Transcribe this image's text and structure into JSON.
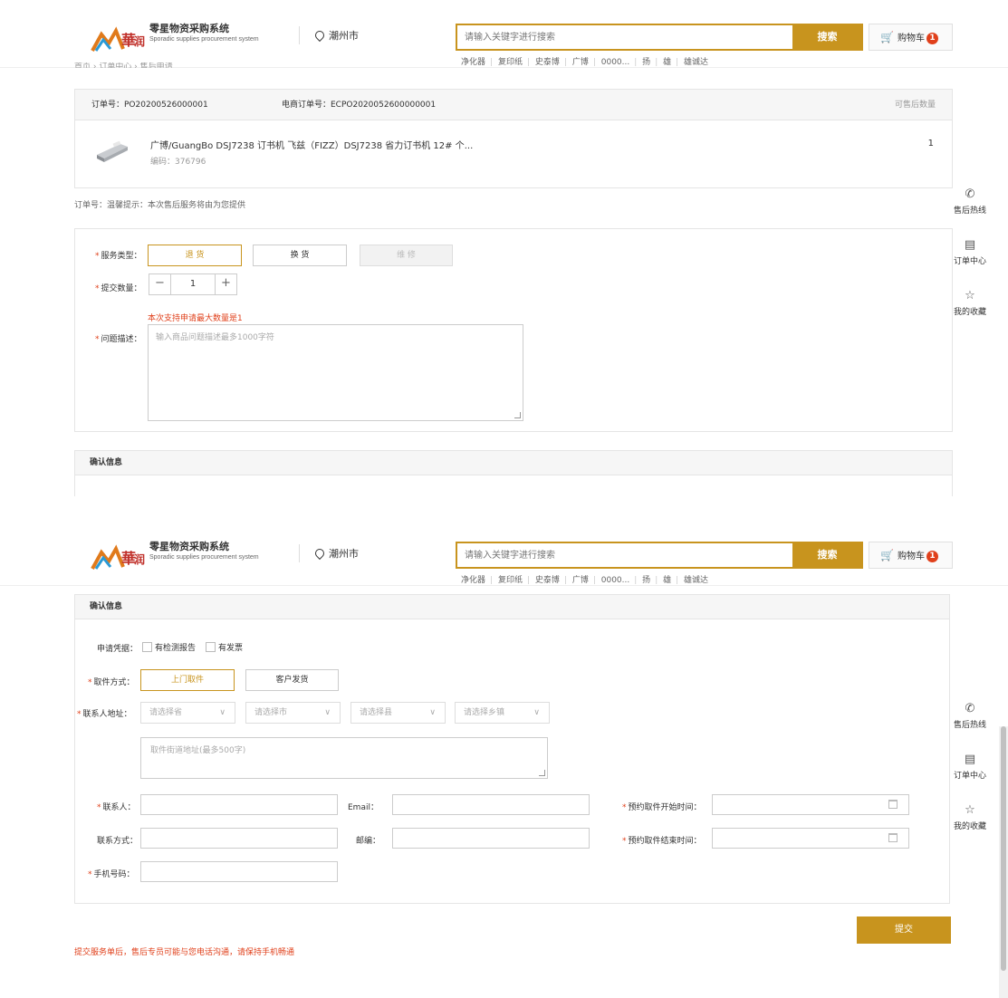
{
  "header": {
    "system_title": "零星物资采购系统",
    "system_subtitle": "Sporadic supplies procurement system",
    "city": "潮州市",
    "search_placeholder": "请输入关键字进行搜索",
    "search_button": "搜索",
    "cart_label": "购物车",
    "cart_count": "1",
    "hot_keywords": [
      "净化器",
      "复印纸",
      "史泰博",
      "广博",
      "0000...",
      "扬",
      "雄",
      "雄诚达"
    ]
  },
  "breadcrumb_cut": "首页 › 订单中心 › 售后申请",
  "float_sidebar": [
    "售后热线",
    "订单中心",
    "我的收藏"
  ],
  "order": {
    "order_no_label": "订单号：PO20200526000001",
    "ecommerce_no_label": "电商订单号：ECPO2020052600000001",
    "qty_header": "可售后数量",
    "product_name": "广博/GuangBo DSJ7238 订书机 飞兹（FIZZ）DSJ7238 省力订书机 12# 个...",
    "product_code": "编码：376796",
    "product_qty": "1"
  },
  "tip": "订单号：温馨提示：本次售后服务将由为您提供",
  "service": {
    "type_label": "服务类型：",
    "types": [
      "退 货",
      "换 货",
      "维 修"
    ],
    "qty_label": "提交数量：",
    "qty_value": "1",
    "max_note": "本次支持申请最大数量是1",
    "desc_label": "问题描述：",
    "desc_placeholder": "输入商品问题描述最多1000字符"
  },
  "confirm": {
    "title": "确认信息",
    "proof_label": "申请凭据：",
    "proof_options": [
      "有检测报告",
      "有发票"
    ],
    "pickup_label": "取件方式：",
    "pickup_options": [
      "上门取件",
      "客户发货"
    ],
    "address_label": "联系人地址：",
    "address_selects": [
      "请选择省",
      "请选择市",
      "请选择县",
      "请选择乡镇"
    ],
    "street_placeholder": "取件街道地址(最多500字)",
    "contact_label": "联系人：",
    "email_label": "Email：",
    "start_time_label": "预约取件开始时间：",
    "phone_label": "联系方式：",
    "zip_label": "邮编：",
    "end_time_label": "预约取件结束时间：",
    "mobile_label": "手机号码："
  },
  "submit_label": "提交",
  "submit_notice": "提交服务单后，售后专员可能与您电话沟通，请保持手机畅通"
}
